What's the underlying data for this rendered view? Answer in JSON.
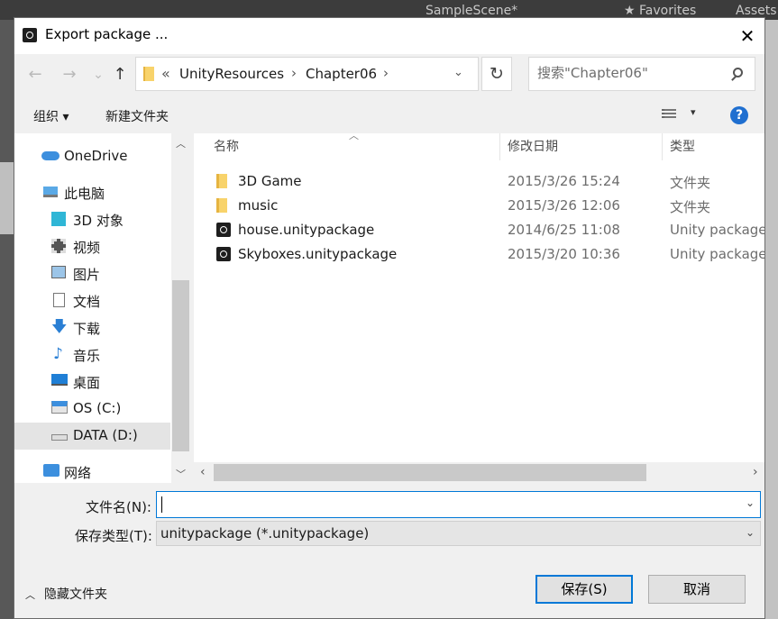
{
  "background": {
    "scene_tab": "SampleScene*",
    "favorites_tab": "Favorites",
    "assets_tab": "Assets"
  },
  "dialog": {
    "title": "Export package ...",
    "close": "✕"
  },
  "nav": {
    "back": "←",
    "forward": "→",
    "recent": "⌄",
    "up": "↑"
  },
  "address": {
    "overflow": "«",
    "crumbs": [
      "UnityResources",
      "Chapter06"
    ],
    "sep": "›",
    "dropdown": "⌄",
    "refresh": "↻"
  },
  "search": {
    "placeholder": "搜索\"Chapter06\""
  },
  "toolbar": {
    "organize": "组织 ▾",
    "new_folder": "新建文件夹",
    "view_dropdown": "▾",
    "help": "?"
  },
  "sidebar": {
    "items": [
      {
        "label": "OneDrive",
        "icon": "cloud-icon"
      },
      {
        "label": "此电脑",
        "icon": "computer-icon"
      },
      {
        "label": "3D 对象",
        "icon": "3d-objects-icon"
      },
      {
        "label": "视频",
        "icon": "video-icon"
      },
      {
        "label": "图片",
        "icon": "pictures-icon"
      },
      {
        "label": "文档",
        "icon": "document-icon"
      },
      {
        "label": "下载",
        "icon": "download-icon"
      },
      {
        "label": "音乐",
        "icon": "music-icon"
      },
      {
        "label": "桌面",
        "icon": "desktop-icon"
      },
      {
        "label": "OS (C:)",
        "icon": "drive-c-icon"
      },
      {
        "label": "DATA (D:)",
        "icon": "drive-d-icon"
      },
      {
        "label": "网络",
        "icon": "network-icon"
      }
    ]
  },
  "columns": {
    "name": "名称",
    "modified": "修改日期",
    "type": "类型"
  },
  "files": [
    {
      "name": "3D Game",
      "date": "2015/3/26 15:24",
      "type": "文件夹",
      "icon": "folder-icon"
    },
    {
      "name": "music",
      "date": "2015/3/26 12:06",
      "type": "文件夹",
      "icon": "folder-icon"
    },
    {
      "name": "house.unitypackage",
      "date": "2014/6/25 11:08",
      "type": "Unity package",
      "icon": "unity-package-icon"
    },
    {
      "name": "Skyboxes.unitypackage",
      "date": "2015/3/20 10:36",
      "type": "Unity package",
      "icon": "unity-package-icon"
    }
  ],
  "form": {
    "filename_label": "文件名(N):",
    "filename_value": "",
    "filetype_label": "保存类型(T):",
    "filetype_value": "unitypackage (*.unitypackage)"
  },
  "footer": {
    "hide_folders": "隐藏文件夹",
    "save": "保存(S)",
    "cancel": "取消"
  }
}
